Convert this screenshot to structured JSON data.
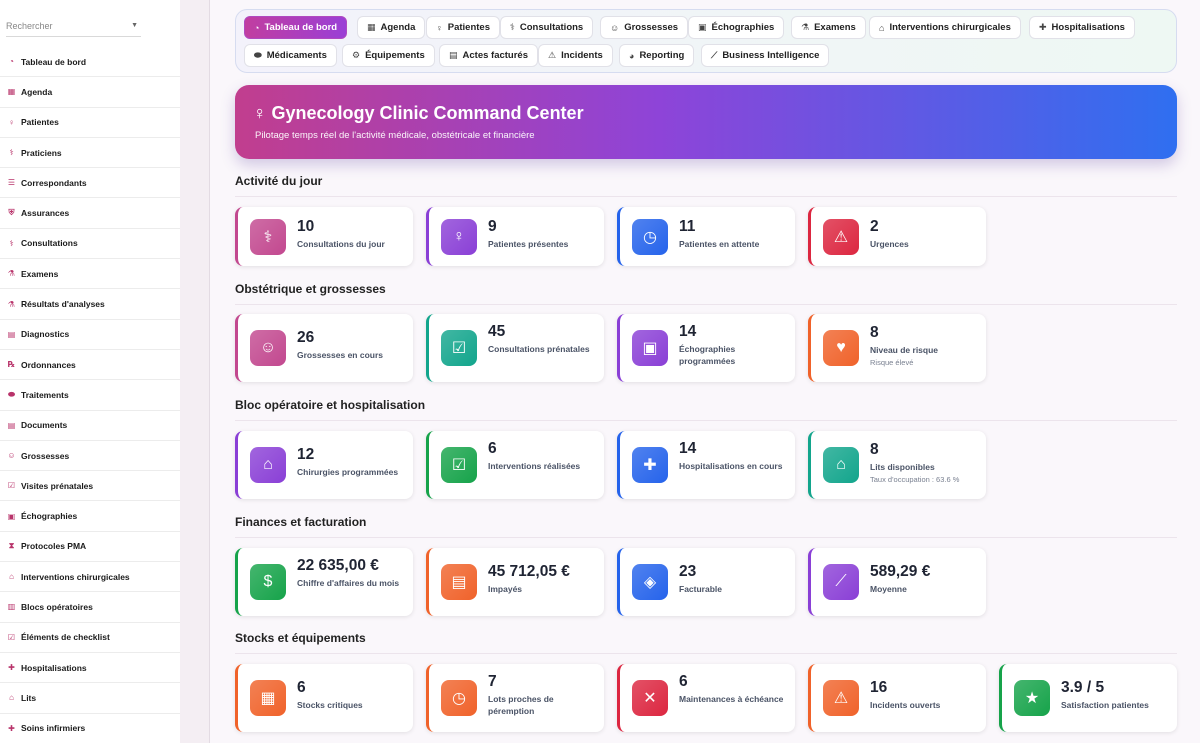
{
  "sidebar": {
    "search_placeholder": "Rechercher",
    "items": [
      {
        "label": "Tableau de bord",
        "icon": "gauge-icon"
      },
      {
        "label": "Agenda",
        "icon": "calendar-icon"
      },
      {
        "label": "Patientes",
        "icon": "venus-icon"
      },
      {
        "label": "Praticiens",
        "icon": "doctor-icon"
      },
      {
        "label": "Correspondants",
        "icon": "contacts-icon"
      },
      {
        "label": "Assurances",
        "icon": "shield-icon"
      },
      {
        "label": "Consultations",
        "icon": "stethoscope-icon"
      },
      {
        "label": "Examens",
        "icon": "microscope-icon"
      },
      {
        "label": "Résultats d'analyses",
        "icon": "flask-icon"
      },
      {
        "label": "Diagnostics",
        "icon": "clipboard-icon"
      },
      {
        "label": "Ordonnances",
        "icon": "prescription-icon"
      },
      {
        "label": "Traitements",
        "icon": "pills-icon"
      },
      {
        "label": "Documents",
        "icon": "document-icon"
      },
      {
        "label": "Grossesses",
        "icon": "baby-icon"
      },
      {
        "label": "Visites prénatales",
        "icon": "calendar-check-icon"
      },
      {
        "label": "Échographies",
        "icon": "monitor-icon"
      },
      {
        "label": "Protocoles PMA",
        "icon": "dna-icon"
      },
      {
        "label": "Interventions chirurgicales",
        "icon": "bed-icon"
      },
      {
        "label": "Blocs opératoires",
        "icon": "building-icon"
      },
      {
        "label": "Éléments de checklist",
        "icon": "checklist-icon"
      },
      {
        "label": "Hospitalisations",
        "icon": "hospital-icon"
      },
      {
        "label": "Lits",
        "icon": "bed-icon"
      },
      {
        "label": "Soins infirmiers",
        "icon": "nurse-icon"
      }
    ]
  },
  "tabs": [
    {
      "label": "Tableau de bord",
      "icon": "gauge-icon",
      "active": true
    },
    {
      "label": "Agenda",
      "icon": "calendar-icon"
    },
    {
      "label": "Patientes",
      "icon": "venus-icon"
    },
    {
      "label": "Consultations",
      "icon": "stethoscope-icon"
    },
    {
      "label": "Grossesses",
      "icon": "baby-icon"
    },
    {
      "label": "Échographies",
      "icon": "monitor-icon"
    },
    {
      "label": "Examens",
      "icon": "microscope-icon"
    },
    {
      "label": "Interventions chirurgicales",
      "icon": "bed-icon"
    },
    {
      "label": "Hospitalisations",
      "icon": "hospital-icon"
    },
    {
      "label": "Médicaments",
      "icon": "pills-icon"
    },
    {
      "label": "Équipements",
      "icon": "gear-icon"
    },
    {
      "label": "Actes facturés",
      "icon": "invoice-icon"
    },
    {
      "label": "Incidents",
      "icon": "warning-icon"
    },
    {
      "label": "Reporting",
      "icon": "pie-chart-icon"
    },
    {
      "label": "Business Intelligence",
      "icon": "line-chart-icon"
    }
  ],
  "hero": {
    "title": "Gynecology Clinic Command Center",
    "subtitle": "Pilotage temps réel de l'activité médicale, obstétricale et financière"
  },
  "sections": [
    {
      "title": "Activité du jour",
      "cards": [
        {
          "value": "10",
          "label": "Consultations du jour",
          "icon": "stethoscope-icon",
          "color": "#c2488f"
        },
        {
          "value": "9",
          "label": "Patientes présentes",
          "icon": "venus-icon",
          "color": "#8a3fd6"
        },
        {
          "value": "11",
          "label": "Patientes en attente",
          "icon": "clock-icon",
          "color": "#2563eb"
        },
        {
          "value": "2",
          "label": "Urgences",
          "icon": "warning-icon",
          "color": "#dc2640"
        }
      ]
    },
    {
      "title": "Obstétrique et grossesses",
      "cards": [
        {
          "value": "26",
          "label": "Grossesses en cours",
          "icon": "baby-icon",
          "color": "#c2488f"
        },
        {
          "value": "45",
          "label": "Consultations prénatales",
          "icon": "calendar-check-icon",
          "color": "#12a58c"
        },
        {
          "value": "14",
          "label": "Échographies programmées",
          "icon": "monitor-icon",
          "color": "#8a3fd6"
        },
        {
          "value": "8",
          "label": "Niveau de risque",
          "sub": "Risque élevé",
          "icon": "heart-pulse-icon",
          "color": "#f0622a"
        }
      ]
    },
    {
      "title": "Bloc opératoire et hospitalisation",
      "cards": [
        {
          "value": "12",
          "label": "Chirurgies programmées",
          "icon": "bed-icon",
          "color": "#8a3fd6"
        },
        {
          "value": "6",
          "label": "Interventions réalisées",
          "icon": "clipboard-check-icon",
          "color": "#16a34a"
        },
        {
          "value": "14",
          "label": "Hospitalisations en cours",
          "icon": "hospital-icon",
          "color": "#2563eb"
        },
        {
          "value": "8",
          "label": "Lits disponibles",
          "sub": "Taux d'occupation : 63.6 %",
          "icon": "bed-icon",
          "color": "#12a58c"
        }
      ]
    },
    {
      "title": "Finances et facturation",
      "cards": [
        {
          "value": "22 635,00 €",
          "label": "Chiffre d'affaires du mois",
          "icon": "money-icon",
          "color": "#16a34a"
        },
        {
          "value": "45 712,05 €",
          "label": "Impayés",
          "icon": "invoice-icon",
          "color": "#f0622a"
        },
        {
          "value": "23",
          "label": "Facturable",
          "icon": "tags-icon",
          "color": "#2563eb"
        },
        {
          "value": "589,29 €",
          "label": "Moyenne",
          "icon": "line-chart-icon",
          "color": "#8a3fd6"
        }
      ]
    },
    {
      "title": "Stocks et équipements",
      "cards": [
        {
          "value": "6",
          "label": "Stocks critiques",
          "icon": "boxes-icon",
          "color": "#f0622a"
        },
        {
          "value": "7",
          "label": "Lots proches de péremption",
          "icon": "clock-icon",
          "color": "#f0622a"
        },
        {
          "value": "6",
          "label": "Maintenances à échéance",
          "icon": "tools-icon",
          "color": "#dc2640"
        },
        {
          "value": "16",
          "label": "Incidents ouverts",
          "icon": "warning-icon",
          "color": "#f0622a"
        },
        {
          "value": "3.9 / 5",
          "label": "Satisfaction patientes",
          "icon": "star-icon",
          "color": "#16a34a"
        }
      ]
    }
  ]
}
